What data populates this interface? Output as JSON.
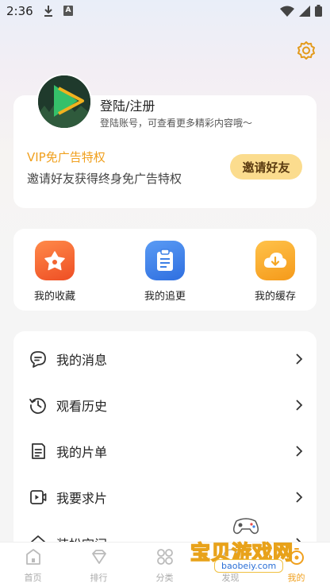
{
  "status_bar": {
    "time": "2:36",
    "a_badge": "A"
  },
  "profile": {
    "login_title": "登陆/注册",
    "login_subtitle": "登陆账号，可查看更多精彩内容哦～",
    "vip_title": "VIP免广告特权",
    "vip_desc": "邀请好友获得终身免广告特权",
    "invite_button": "邀请好友"
  },
  "quick_actions": [
    {
      "label": "我的收藏",
      "icon": "star-icon",
      "color": "#f26430"
    },
    {
      "label": "我的追更",
      "icon": "clipboard-icon",
      "color": "#3d80e6"
    },
    {
      "label": "我的缓存",
      "icon": "cloud-download-icon",
      "color": "#f5a623"
    }
  ],
  "menu": [
    {
      "label": "我的消息",
      "icon": "message-icon"
    },
    {
      "label": "观看历史",
      "icon": "history-icon"
    },
    {
      "label": "我的片单",
      "icon": "list-icon"
    },
    {
      "label": "我要求片",
      "icon": "video-request-icon"
    },
    {
      "label": "装扮空间",
      "icon": "dress-up-icon"
    }
  ],
  "tabs": [
    {
      "label": "首页",
      "icon": "home-icon",
      "active": false
    },
    {
      "label": "排行",
      "icon": "rank-icon",
      "active": false
    },
    {
      "label": "分类",
      "icon": "category-icon",
      "active": false
    },
    {
      "label": "发现",
      "icon": "discover-icon",
      "active": false
    },
    {
      "label": "我的",
      "icon": "profile-icon",
      "active": true
    }
  ],
  "watermark": {
    "title": "宝贝游戏网",
    "url": "baobeiy.com"
  },
  "colors": {
    "accent": "#f0a01e",
    "invite_bg": "#fbdc8e"
  }
}
